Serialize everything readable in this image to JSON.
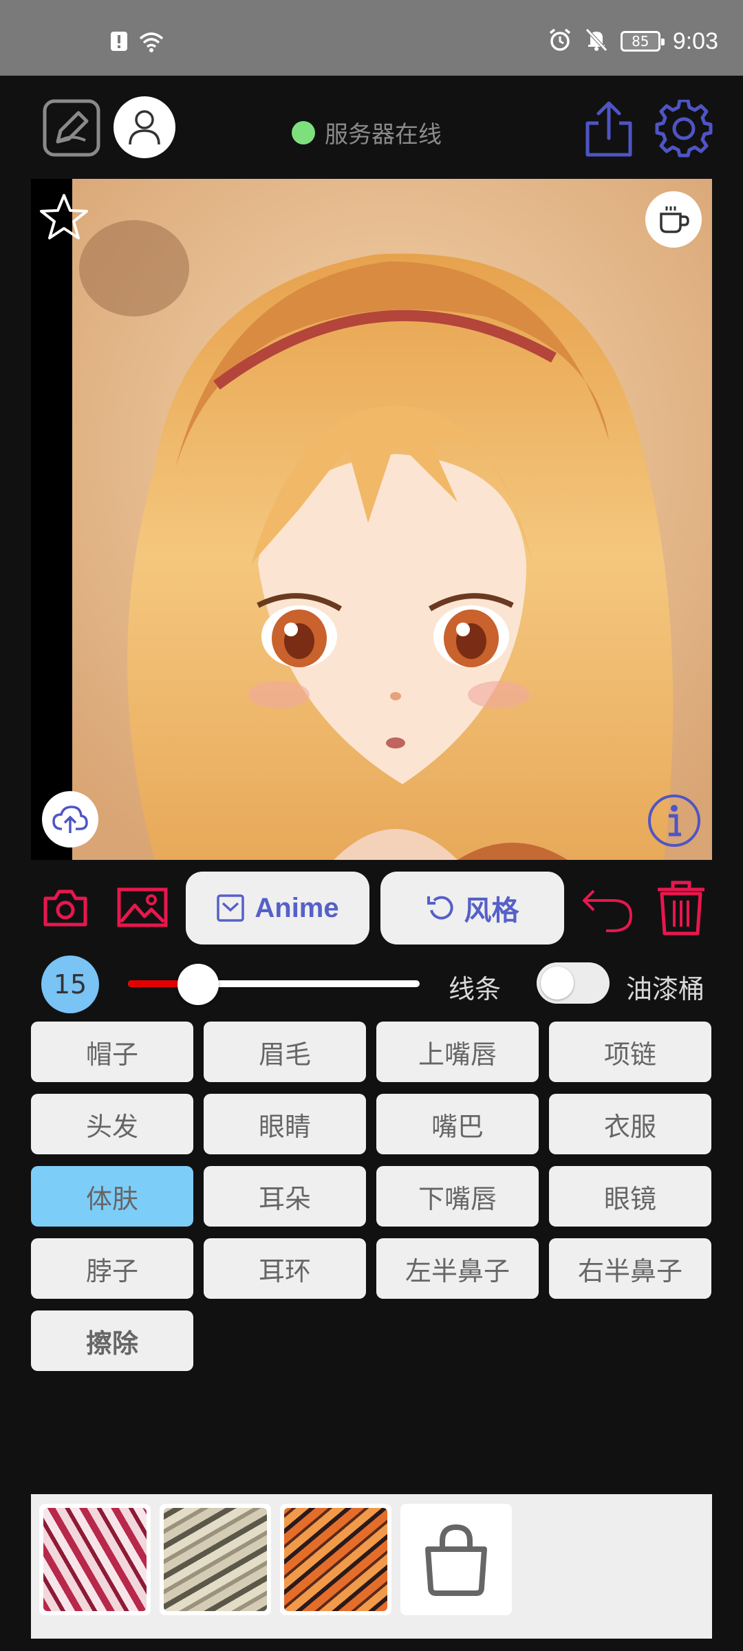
{
  "status_bar": {
    "time": "9:03",
    "battery": "85"
  },
  "header": {
    "server_status": "服务器在线"
  },
  "toolbar": {
    "anime_label": "Anime",
    "style_label": "风格"
  },
  "brush": {
    "size": "15",
    "line_label": "线条",
    "bucket_label": "油漆桶",
    "size_fraction": 0.24,
    "bucket_enabled": false
  },
  "parts": [
    {
      "label": "帽子"
    },
    {
      "label": "眉毛"
    },
    {
      "label": "上嘴唇"
    },
    {
      "label": "项链"
    },
    {
      "label": "头发"
    },
    {
      "label": "眼睛"
    },
    {
      "label": "嘴巴"
    },
    {
      "label": "衣服"
    },
    {
      "label": "体肤"
    },
    {
      "label": "耳朵"
    },
    {
      "label": "下嘴唇"
    },
    {
      "label": "眼镜"
    },
    {
      "label": "脖子"
    },
    {
      "label": "耳环"
    },
    {
      "label": "左半鼻子"
    },
    {
      "label": "右半鼻子"
    },
    {
      "label": "擦除"
    }
  ],
  "selected_part": "体肤",
  "colors": {
    "accent_red": "#e8174d",
    "accent_blue": "#5560c8",
    "selected": "#7dcdf9",
    "server_online": "#7ee07c"
  }
}
